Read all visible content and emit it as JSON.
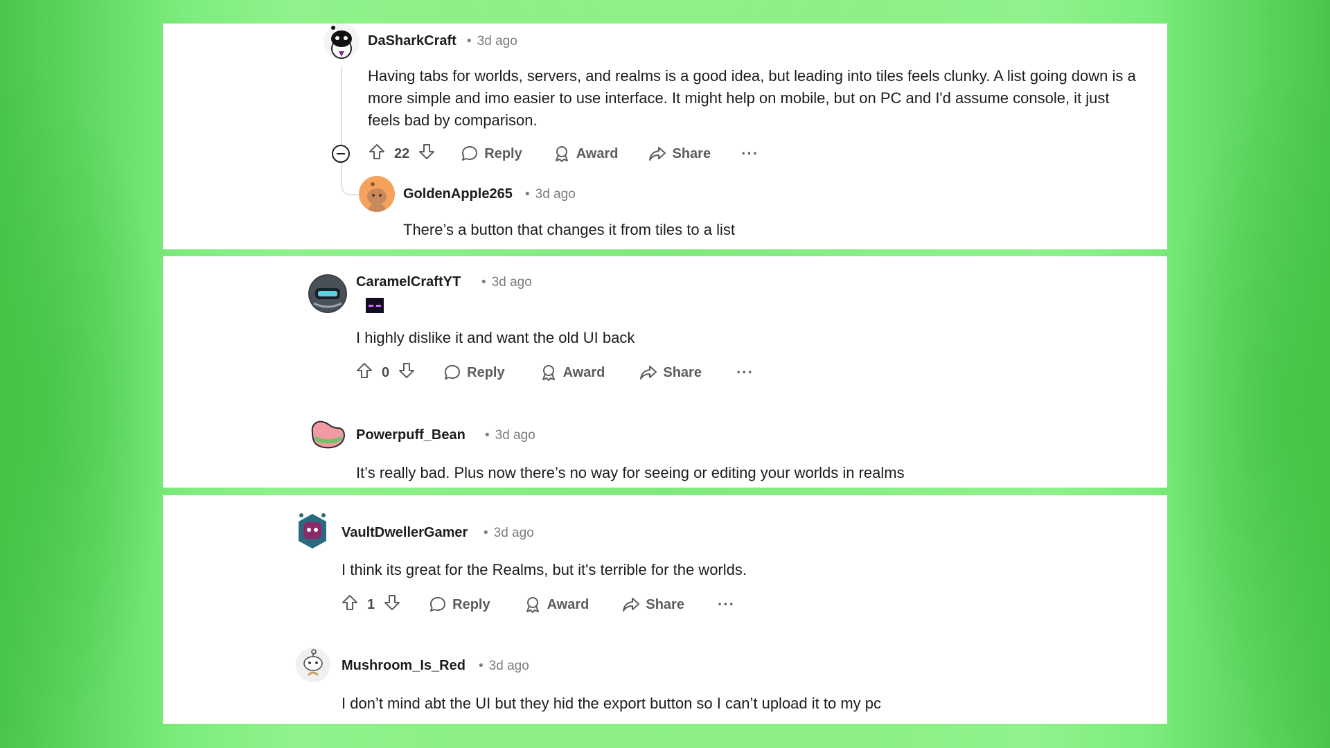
{
  "comments": [
    {
      "username": "DaSharkCraft",
      "time": "3d ago",
      "text": "Having tabs for worlds, servers, and realms is a good idea, but leading into tiles feels clunky. A list going down is a more simple and imo easier to use interface. It might help on mobile, but on PC and I'd assume console, it just feels bad by comparison.",
      "votes": "22",
      "avatar_icon": "snoo-shark-avatar",
      "reply": {
        "username": "GoldenApple265",
        "time": "3d ago",
        "text": "There’s a button that changes it from tiles to a list",
        "avatar_icon": "snoo-orange-avatar"
      }
    },
    {
      "username": "CaramelCraftYT",
      "time": "3d ago",
      "flair_icon": "enderman-flair-icon",
      "text": "I highly dislike it and want the old UI back",
      "votes": "0",
      "avatar_icon": "helmet-avatar",
      "reply": {
        "username": "Powerpuff_Bean",
        "time": "3d ago",
        "text": "It’s really bad. Plus now there’s no way for seeing or editing your worlds in realms",
        "avatar_icon": "bean-avatar"
      }
    },
    {
      "username": "VaultDwellerGamer",
      "time": "3d ago",
      "text": "I think its great for the Realms, but it's terrible for the worlds.",
      "votes": "1",
      "avatar_icon": "robot-avatar",
      "reply": {
        "username": "Mushroom_Is_Red",
        "time": "3d ago",
        "text": "I don’t mind abt the UI but they hid the export button so I can’t upload it to my pc",
        "avatar_icon": "snoo-sketch-avatar"
      }
    }
  ],
  "actions": {
    "reply": "Reply",
    "award": "Award",
    "share": "Share",
    "more": "···"
  },
  "dot": "•",
  "colors": {
    "background_green": "#7fea7c",
    "card": "#ffffff",
    "text": "#1c1c1c",
    "meta": "#7c7c7c"
  }
}
